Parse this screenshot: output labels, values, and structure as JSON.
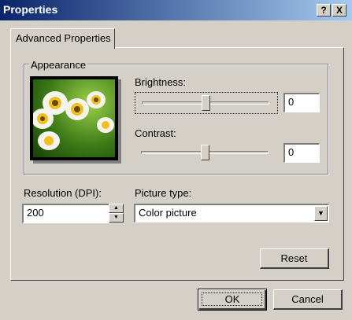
{
  "window": {
    "title": "Properties"
  },
  "title_buttons": {
    "help": "?",
    "close": "X"
  },
  "tab": {
    "label": "Advanced Properties"
  },
  "appearance": {
    "group_label": "Appearance",
    "brightness_label": "Brightness:",
    "brightness_value": "0",
    "contrast_label": "Contrast:",
    "contrast_value": "0"
  },
  "resolution": {
    "label": "Resolution (DPI):",
    "value": "200"
  },
  "picture_type": {
    "label": "Picture type:",
    "selected": "Color picture"
  },
  "buttons": {
    "reset": "Reset",
    "ok": "OK",
    "cancel": "Cancel"
  },
  "colors": {
    "title_start": "#0a246a",
    "title_end": "#a6caf0",
    "face": "#d4d0c8"
  }
}
